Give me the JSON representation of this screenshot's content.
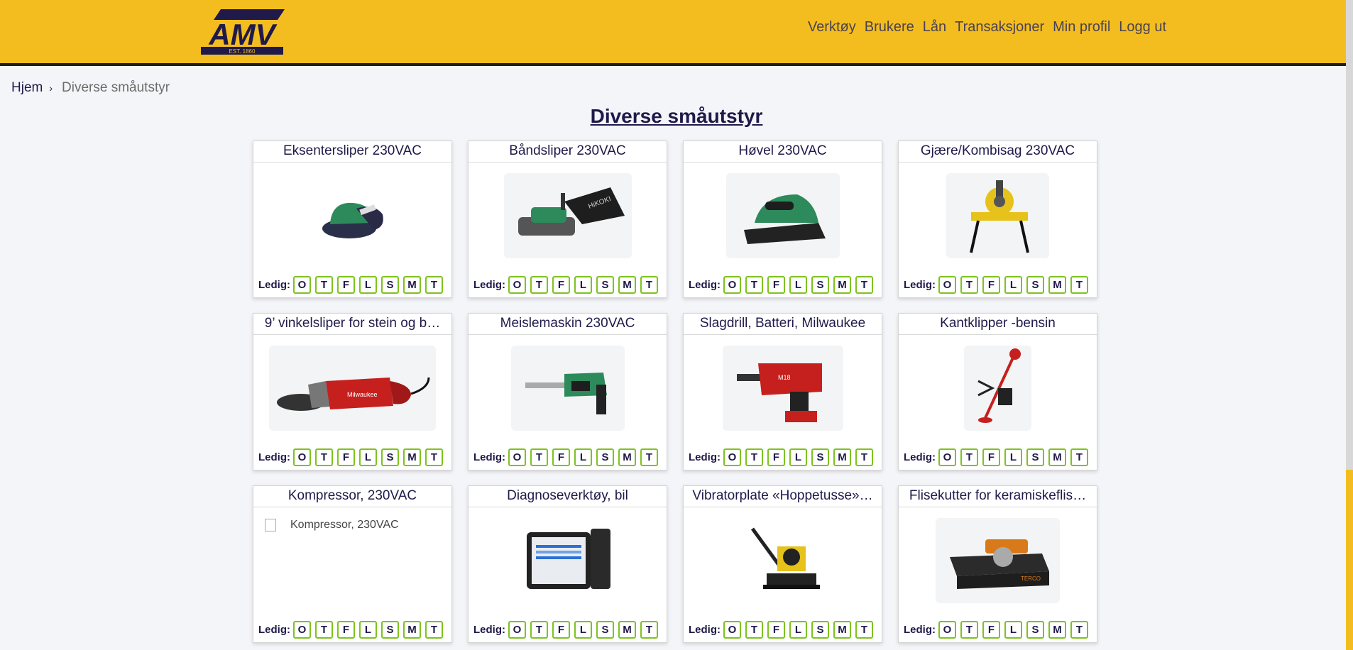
{
  "header": {
    "logo_text": "AMV",
    "logo_sub": "EST. 1860",
    "nav": [
      "Verktøy",
      "Brukere",
      "Lån",
      "Transaksjoner",
      "Min profil",
      "Logg ut"
    ]
  },
  "breadcrumb": {
    "home": "Hjem",
    "current": "Diverse småutstyr"
  },
  "page_title": "Diverse småutstyr",
  "availability_label": "Ledig:",
  "days": [
    "O",
    "T",
    "F",
    "L",
    "S",
    "M",
    "T"
  ],
  "tools": [
    {
      "title": "Eksentersliper 230VAC",
      "icon": "random-orbit-sander"
    },
    {
      "title": "Båndsliper 230VAC",
      "icon": "belt-sander"
    },
    {
      "title": "Høvel 230VAC",
      "icon": "planer"
    },
    {
      "title": "Gjære/Kombisag 230VAC",
      "icon": "mitre-saw"
    },
    {
      "title": "9’ vinkelsliper for stein og b…",
      "icon": "angle-grinder"
    },
    {
      "title": "Meislemaskin 230VAC",
      "icon": "demolition-hammer"
    },
    {
      "title": "Slagdrill, Batteri, Milwaukee",
      "icon": "rotary-hammer"
    },
    {
      "title": "Kantklipper -bensin",
      "icon": "string-trimmer"
    },
    {
      "title": "Kompressor, 230VAC",
      "icon": "broken-image",
      "alt": "Kompressor, 230VAC"
    },
    {
      "title": "Diagnoseverktøy, bil",
      "icon": "diagnostic-tablet"
    },
    {
      "title": "Vibratorplate «Hoppetusse»…",
      "icon": "plate-compactor"
    },
    {
      "title": "Flisekutter for keramiskeflis…",
      "icon": "tile-saw"
    }
  ],
  "colors": {
    "header": "#f4bd1f",
    "accent": "#1f1a4a",
    "available": "#7dc31f"
  }
}
